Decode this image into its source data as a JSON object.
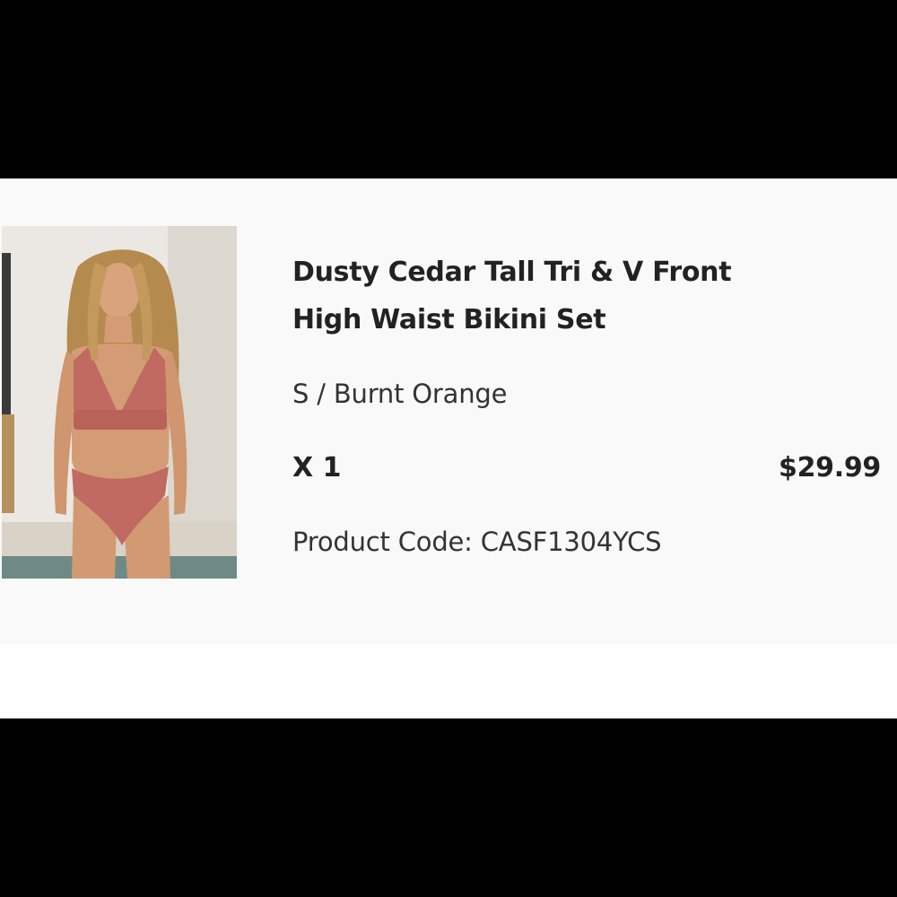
{
  "product": {
    "title_line1": "Dusty Cedar Tall Tri & V Front",
    "title_line2": "High Waist Bikini Set",
    "variant": "S / Burnt Orange",
    "quantity": "X 1",
    "price": "$29.99",
    "product_code": "Product Code: CASF1304YCS",
    "image_icon": "product-photo"
  },
  "colors": {
    "swimsuit": "#c06a62",
    "card_background": "#f9f9f9",
    "text_primary": "#222222"
  }
}
